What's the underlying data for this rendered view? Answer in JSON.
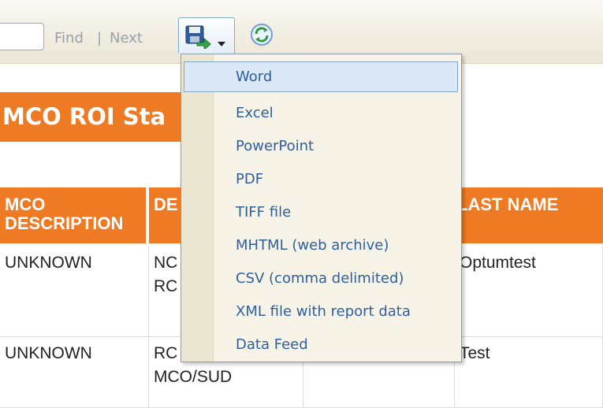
{
  "toolbar": {
    "find_label": "Find",
    "separator": "|",
    "next_label": "Next"
  },
  "report": {
    "title": "MCO ROI Sta",
    "columns": {
      "mco_description": "MCO DESCRIPTION",
      "de": "DE",
      "last_name": "LAST NAME"
    },
    "rows": [
      {
        "mco_description": "UNKNOWN",
        "description": "NC\nRC",
        "last_name": "Optumtest"
      },
      {
        "mco_description": "UNKNOWN",
        "description": "RC\nMCO/SUD",
        "last_name": "Test"
      }
    ]
  },
  "export_menu": {
    "selected": "Word",
    "items": [
      "Word",
      "Excel",
      "PowerPoint",
      "PDF",
      "TIFF file",
      "MHTML (web archive)",
      "CSV (comma delimited)",
      "XML file with report data",
      "Data Feed"
    ]
  },
  "colors": {
    "header_orange": "#ef7a24",
    "menu_text": "#2d5e9e",
    "menu_background": "#f7f4e7",
    "selection_background": "#dbe8f6",
    "selection_border": "#7fa6cf"
  },
  "icons": {
    "export": "save-disk-arrow-icon",
    "dropdown": "chevron-down-icon",
    "refresh": "refresh-icon"
  }
}
